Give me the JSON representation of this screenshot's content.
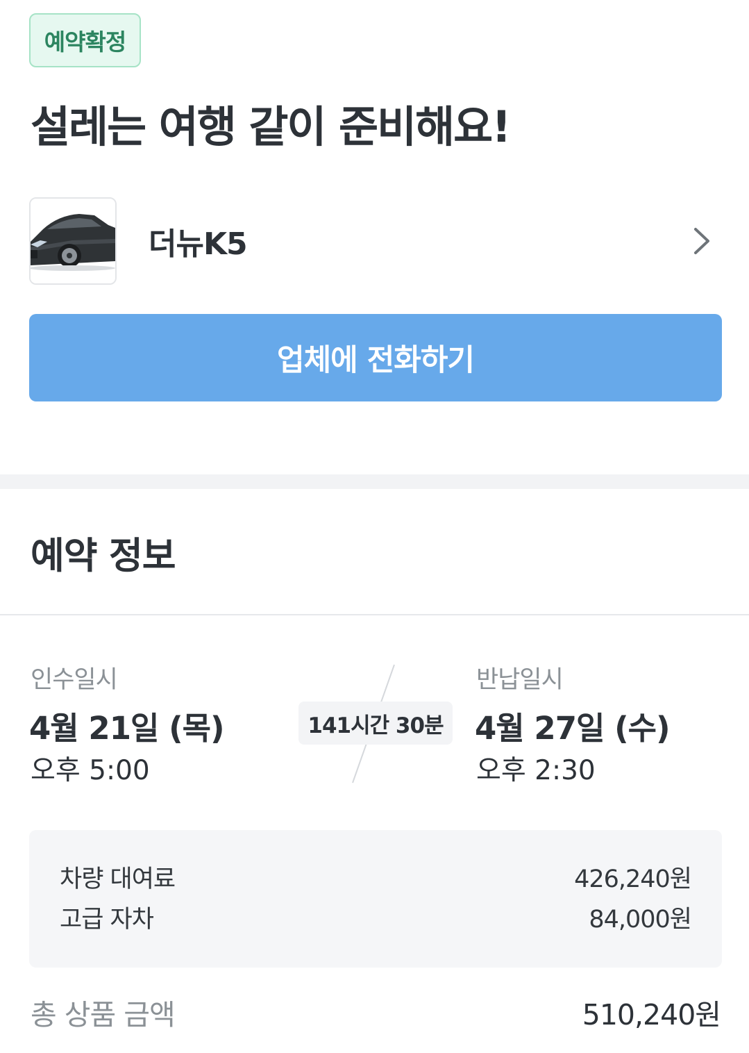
{
  "status_badge": "예약확정",
  "headline": "설레는 여행 같이 준비해요!",
  "car": {
    "name": "더뉴K5",
    "image_icon": "car-photo"
  },
  "call_button": "업체에 전화하기",
  "reservation": {
    "title": "예약 정보",
    "pickup": {
      "label": "인수일시",
      "date": "4월 21일 (목)",
      "time": "오후 5:00"
    },
    "duration": "141시간 30분",
    "return": {
      "label": "반납일시",
      "date": "4월 27일 (수)",
      "time": "오후 2:30"
    },
    "fees": [
      {
        "label": "차량 대여료",
        "amount": "426,240원"
      },
      {
        "label": "고급 자차",
        "amount": "84,000원"
      }
    ],
    "total": {
      "label": "총 상품 금액",
      "amount": "510,240원"
    }
  },
  "colors": {
    "accent_blue": "#67a9ea",
    "badge_green": "#2c8560",
    "badge_bg": "#e6f8f0"
  }
}
